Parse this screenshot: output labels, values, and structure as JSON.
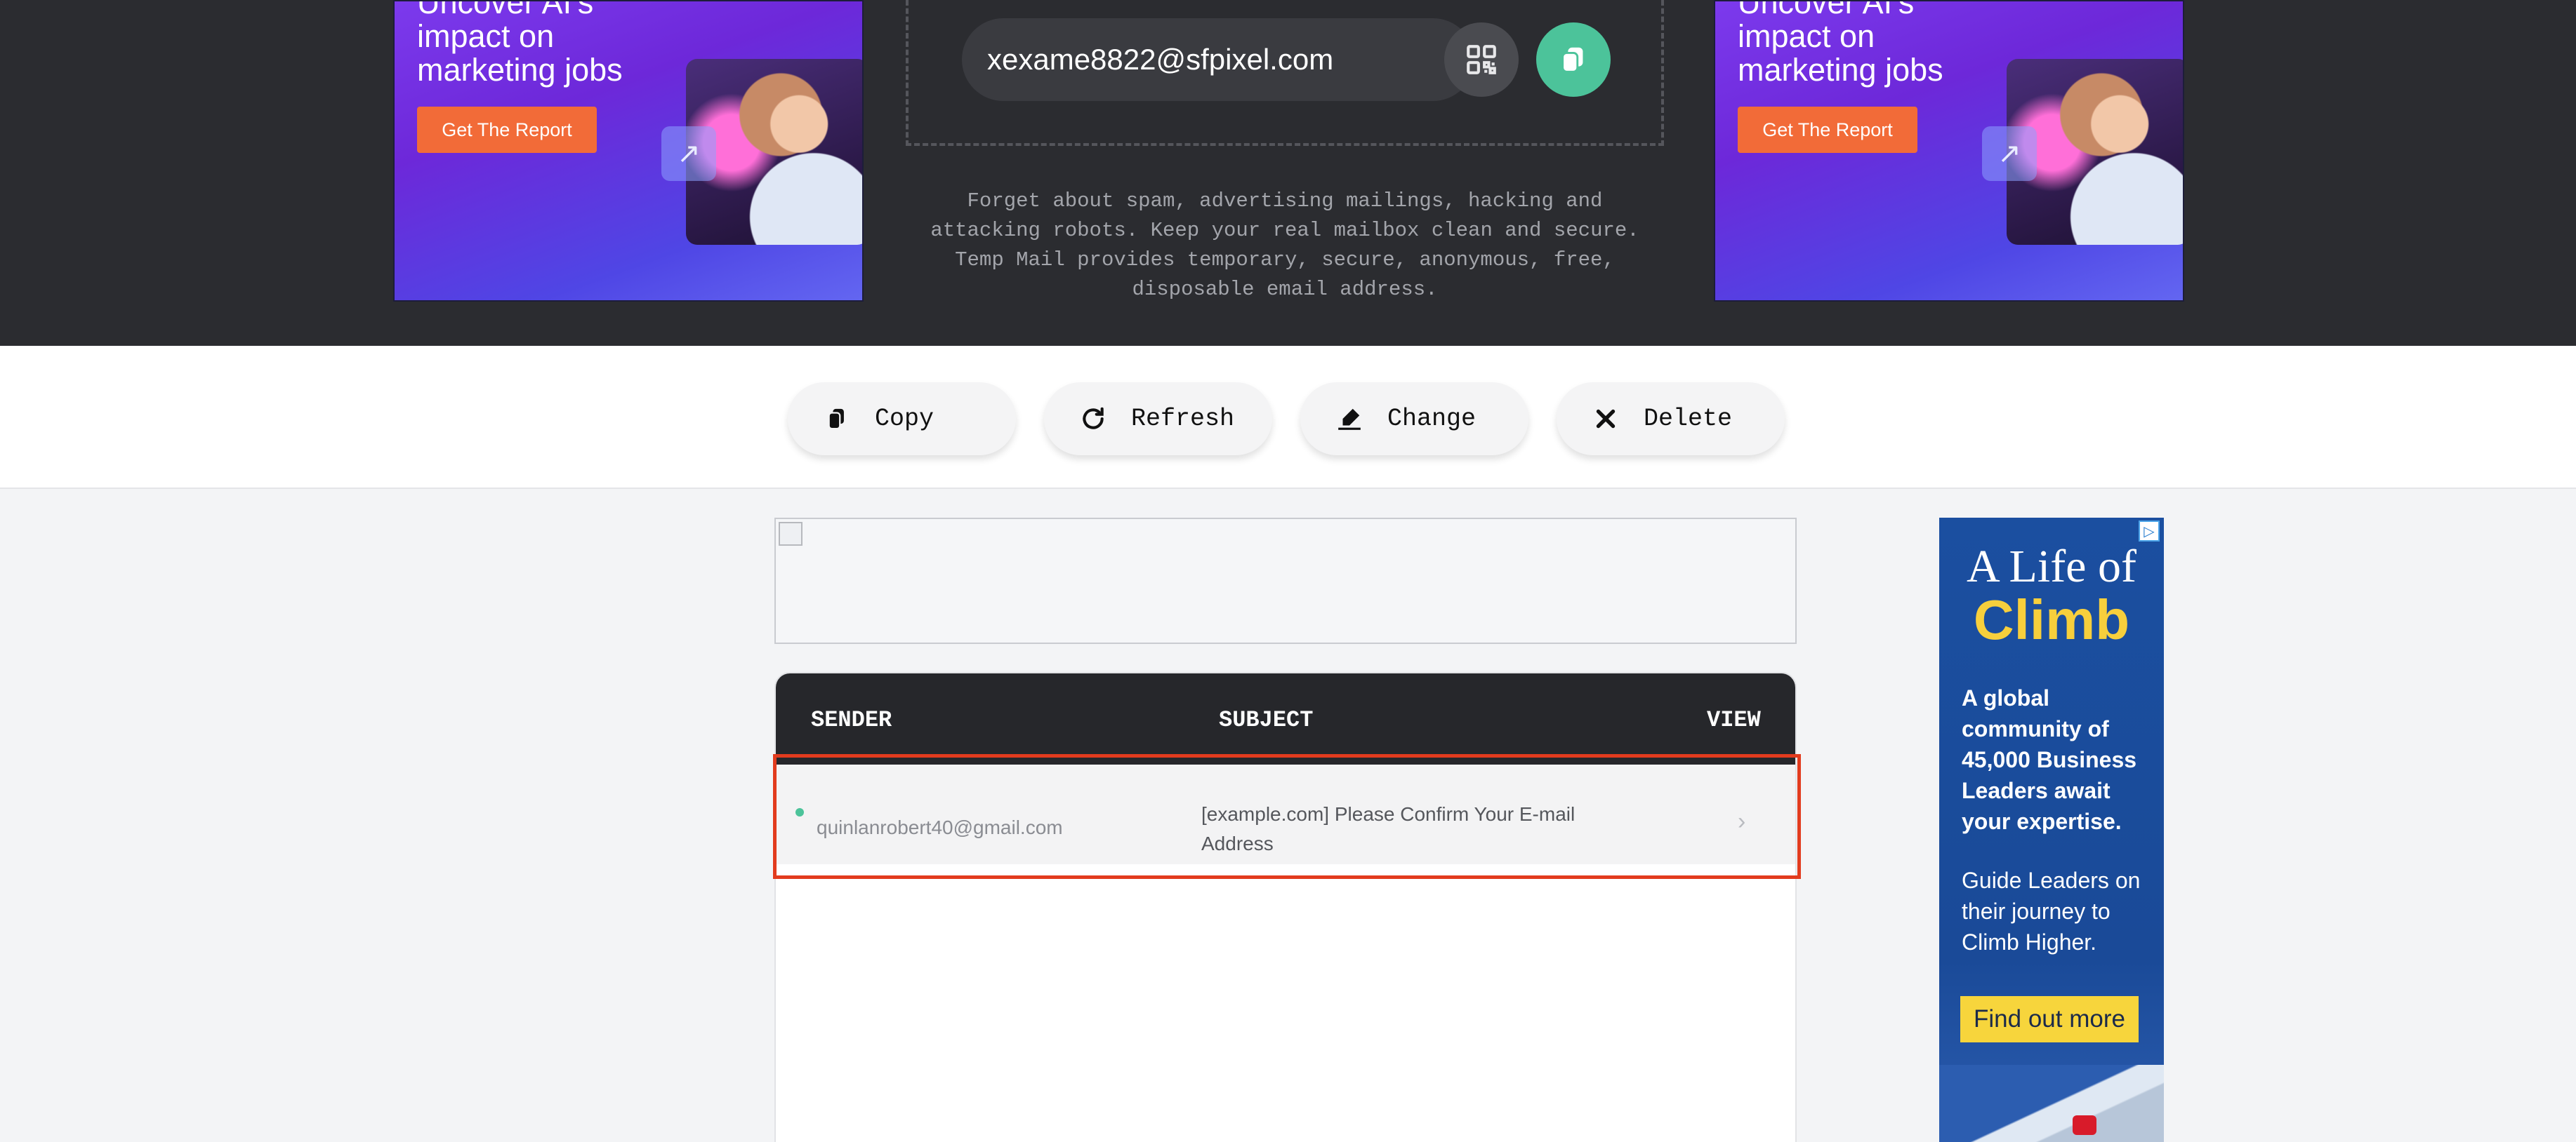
{
  "hero": {
    "ad_headline": "Uncover AI's impact on marketing jobs",
    "ad_button": "Get The Report",
    "email": "xexame8822@sfpixel.com",
    "qr_icon": "qr-code-icon",
    "copy_icon": "copy-icon",
    "tagline": "Forget about spam, advertising mailings, hacking and attacking robots. Keep your real mailbox clean and secure. Temp Mail provides temporary, secure, anonymous, free, disposable email address."
  },
  "actions": [
    {
      "label": "Copy",
      "icon": "copy-icon"
    },
    {
      "label": "Refresh",
      "icon": "refresh-icon"
    },
    {
      "label": "Change",
      "icon": "edit-icon"
    },
    {
      "label": "Delete",
      "icon": "close-icon"
    }
  ],
  "inbox": {
    "columns": {
      "sender": "SENDER",
      "subject": "SUBJECT",
      "view": "VIEW"
    },
    "messages": [
      {
        "sender": "quinlanrobert40@gmail.com",
        "subject": "[example.com] Please Confirm Your E-mail Address",
        "unread": true
      }
    ]
  },
  "sky_ad": {
    "title1": "A Life of",
    "title2": "Climb",
    "body1": "A global community of 45,000 Business Leaders await your expertise.",
    "body2": "Guide Leaders on their journey to Climb Higher.",
    "cta": "Find out more"
  },
  "colors": {
    "accent_green": "#4cc39a",
    "highlight_red": "#e23b1e",
    "ad_orange": "#f26b38"
  }
}
